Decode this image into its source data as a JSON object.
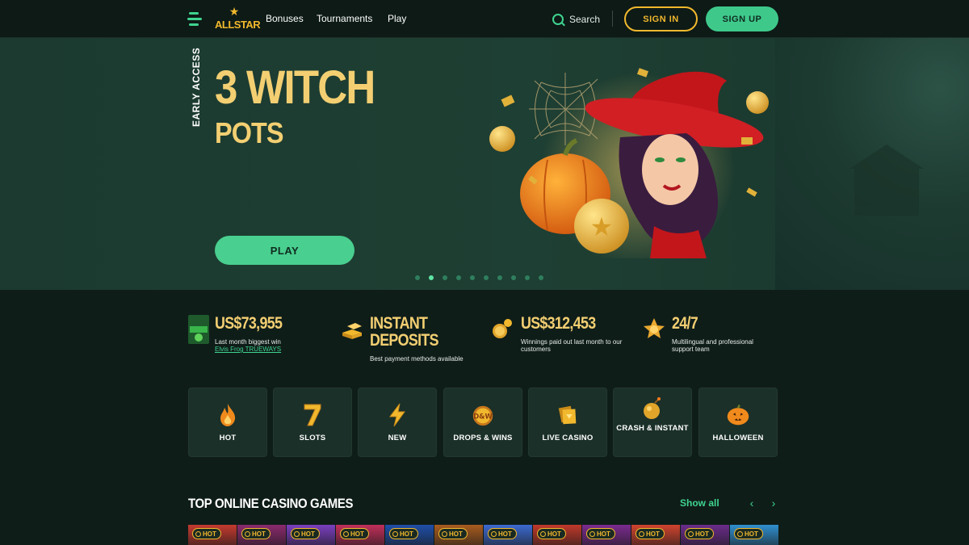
{
  "header": {
    "brand": "ALLSTAR",
    "nav": [
      "Bonuses",
      "Tournaments",
      "Play"
    ],
    "search_label": "Search",
    "sign_in": "SIGN IN",
    "sign_up": "SIGN UP"
  },
  "hero": {
    "badge": "EARLY ACCESS",
    "title": "3 WITCH",
    "subtitle": "POTS",
    "cta": "PLAY",
    "slides_total": 10,
    "active_slide": 2
  },
  "stats": [
    {
      "title": "US$73,955",
      "desc": "Last month biggest win",
      "link": "Elvis Frog TRUEWAYS"
    },
    {
      "title_lines": [
        "INSTANT",
        "DEPOSITS"
      ],
      "desc": "Best payment methods available"
    },
    {
      "title": "US$312,453",
      "desc": "Winnings paid out last month to our customers"
    },
    {
      "title": "24/7",
      "desc": "Multilingual and professional support team"
    }
  ],
  "categories": [
    "HOT",
    "SLOTS",
    "NEW",
    "DROPS & WINS",
    "LIVE CASINO",
    "CRASH & INSTANT",
    "HALLOWEEN"
  ],
  "top_games": {
    "title": "TOP ONLINE CASINO GAMES",
    "show_all": "Show all",
    "badge": "HOT",
    "tile_colors": [
      "#c43a2f",
      "#8a2a6d",
      "#7a3fbf",
      "#c12f5a",
      "#1e4fa8",
      "#a85c1f",
      "#3c6ad1",
      "#c0392b",
      "#7b2b8f",
      "#d1442f",
      "#6a2c8a",
      "#2f8fcf"
    ]
  },
  "colors": {
    "accent_green": "#3ec98b",
    "accent_gold": "#f1b82d",
    "background": "#0f1d19"
  }
}
